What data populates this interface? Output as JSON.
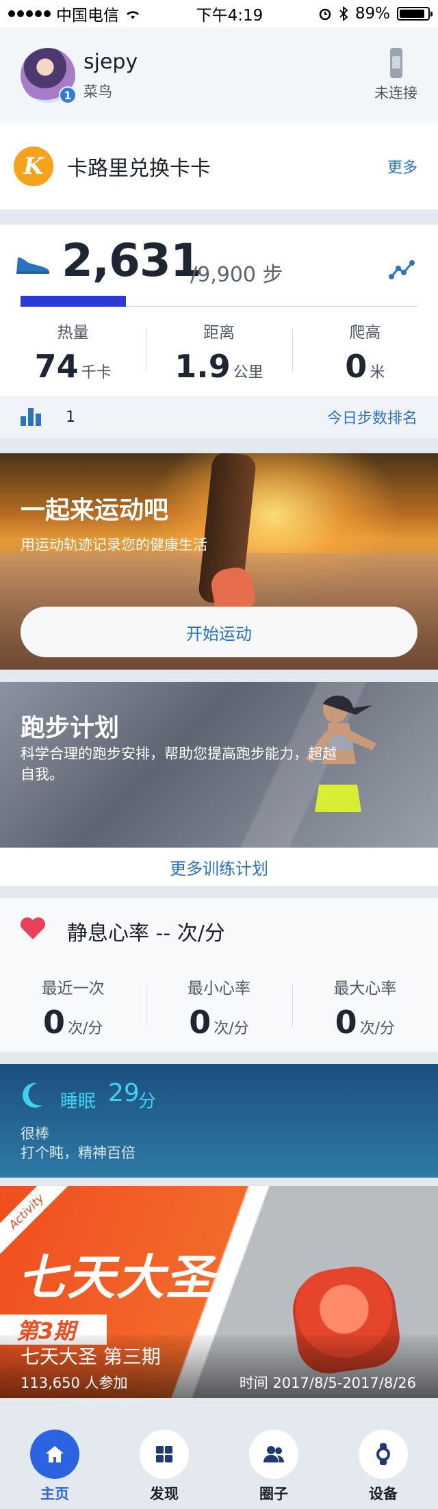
{
  "status_bar": {
    "carrier": "中国电信",
    "time": "下午4:19",
    "battery": "89%",
    "battery_level": 0.89
  },
  "profile": {
    "name": "sjepy",
    "rank": "菜鸟",
    "level": "1",
    "device_status": "未连接"
  },
  "kcard": {
    "logo": "K",
    "title": "卡路里兑换卡卡",
    "more": "更多"
  },
  "steps": {
    "count": "2,631",
    "goal": "/9,900 步",
    "progress": 0.2657,
    "stats": [
      {
        "label": "热量",
        "value": "74",
        "unit": "千卡"
      },
      {
        "label": "距离",
        "value": "1.9",
        "unit": "公里"
      },
      {
        "label": "爬高",
        "value": "0",
        "unit": "米"
      }
    ],
    "rank_value": "1",
    "rank_link": "今日步数排名"
  },
  "sport_banner": {
    "title": "一起来运动吧",
    "subtitle": "用运动轨迹记录您的健康生活",
    "button": "开始运动"
  },
  "plan_banner": {
    "title": "跑步计划",
    "subtitle": "科学合理的跑步安排，帮助您提高跑步能力，超越自我。",
    "more_link": "更多训练计划"
  },
  "heart_rate": {
    "title": "静息心率 -- 次/分",
    "stats": [
      {
        "label": "最近一次",
        "value": "0",
        "unit": "次/分"
      },
      {
        "label": "最小心率",
        "value": "0",
        "unit": "次/分"
      },
      {
        "label": "最大心率",
        "value": "0",
        "unit": "次/分"
      }
    ]
  },
  "sleep": {
    "label": "睡眠",
    "value": "29",
    "unit": "分",
    "quality": "很棒",
    "comment": "打个盹，精神百倍"
  },
  "activity": {
    "ribbon": "Activity",
    "banner_title": "七天大圣",
    "period_tag": "第3期",
    "name": "七天大圣 第三期",
    "participants": "113,650 人参加",
    "time": "时间 2017/8/5-2017/8/26"
  },
  "tabbar": [
    {
      "label": "主页",
      "icon": "home-icon",
      "active": true
    },
    {
      "label": "发现",
      "icon": "discover-icon",
      "active": false
    },
    {
      "label": "圈子",
      "icon": "people-icon",
      "active": false
    },
    {
      "label": "设备",
      "icon": "watch-icon",
      "active": false
    }
  ],
  "colors": {
    "accent": "#2b63e0",
    "link": "#2a73c2",
    "progress": "#2b3ad6",
    "heart": "#e8415b",
    "sleep_accent": "#3fd2f2",
    "activity": "#f04e1f"
  }
}
